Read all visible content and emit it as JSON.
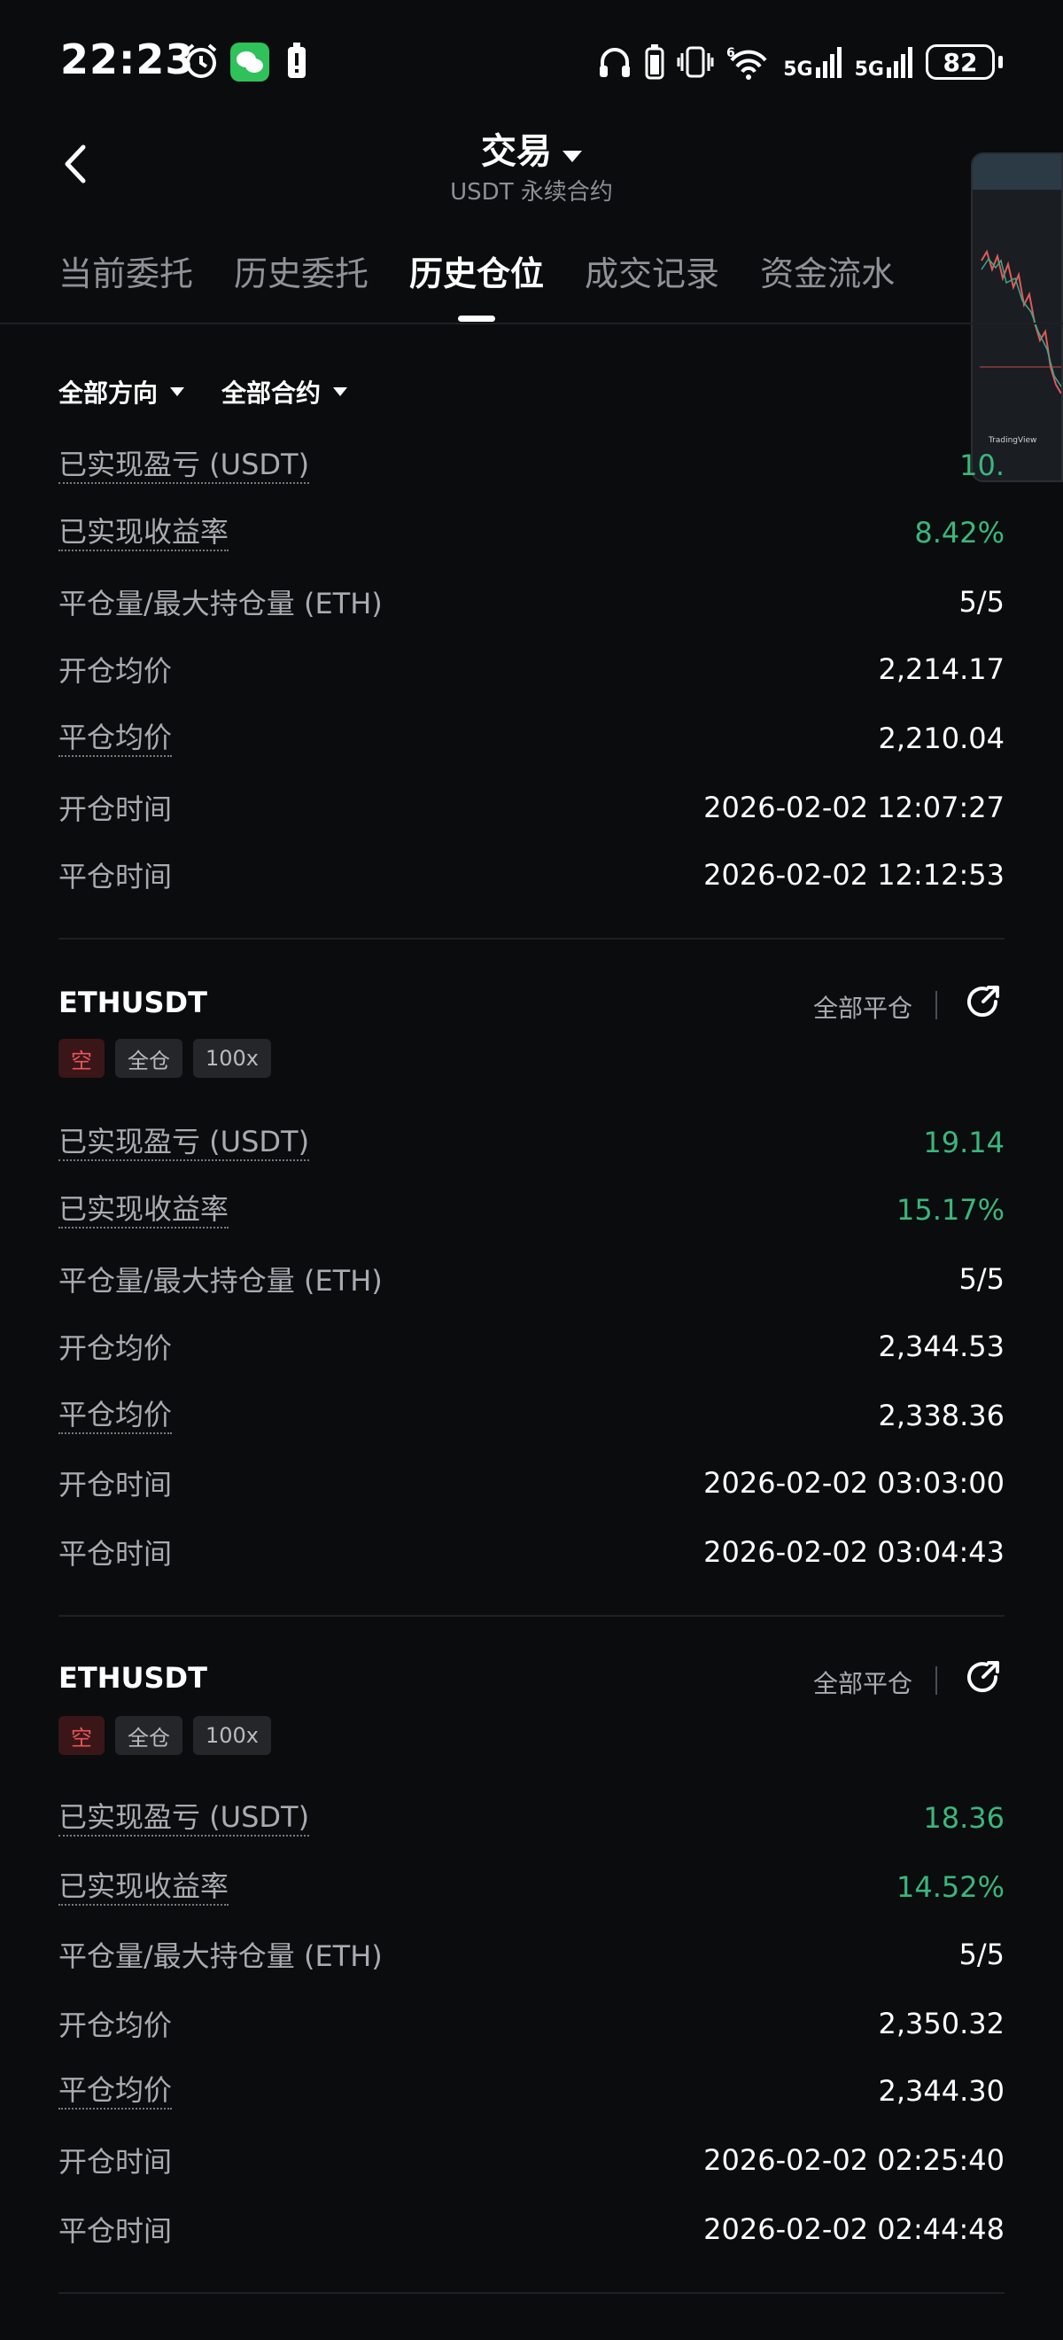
{
  "status_bar": {
    "time": "22:23",
    "battery": "82",
    "net1": "5G",
    "net2": "5G",
    "sim": "6"
  },
  "header": {
    "title": "交易",
    "subtitle": "USDT 永续合约"
  },
  "tabs": [
    {
      "label": "当前委托"
    },
    {
      "label": "历史委托"
    },
    {
      "label": "历史仓位",
      "active": true
    },
    {
      "label": "成交记录"
    },
    {
      "label": "资金流水"
    }
  ],
  "filters": {
    "direction": "全部方向",
    "contract": "全部合约"
  },
  "preview": {
    "footer": "TradingView"
  },
  "labels": {
    "pnl": "已实现盈亏 (USDT)",
    "roi": "已实现收益率",
    "qty": "平仓量/最大持仓量 (ETH)",
    "open_price": "开仓均价",
    "close_price": "平仓均价",
    "open_time": "开仓时间",
    "close_time": "平仓时间",
    "close_all": "全部平仓"
  },
  "positions": [
    {
      "pnl": "10.",
      "roi": "8.42%",
      "qty": "5/5",
      "open_price": "2,214.17",
      "close_price": "2,210.04",
      "open_time": "2026-02-02 12:07:27",
      "close_time": "2026-02-02 12:12:53"
    },
    {
      "symbol": "ETHUSDT",
      "tags": [
        "空",
        "全仓",
        "100x"
      ],
      "pnl": "19.14",
      "roi": "15.17%",
      "qty": "5/5",
      "open_price": "2,344.53",
      "close_price": "2,338.36",
      "open_time": "2026-02-02 03:03:00",
      "close_time": "2026-02-02 03:04:43"
    },
    {
      "symbol": "ETHUSDT",
      "tags": [
        "空",
        "全仓",
        "100x"
      ],
      "pnl": "18.36",
      "roi": "14.52%",
      "qty": "5/5",
      "open_price": "2,350.32",
      "close_price": "2,344.30",
      "open_time": "2026-02-02 02:25:40",
      "close_time": "2026-02-02 02:44:48"
    }
  ],
  "colors": {
    "green": "#39b77d",
    "short_red": "#e8555c",
    "bg": "#0b0c0d"
  }
}
